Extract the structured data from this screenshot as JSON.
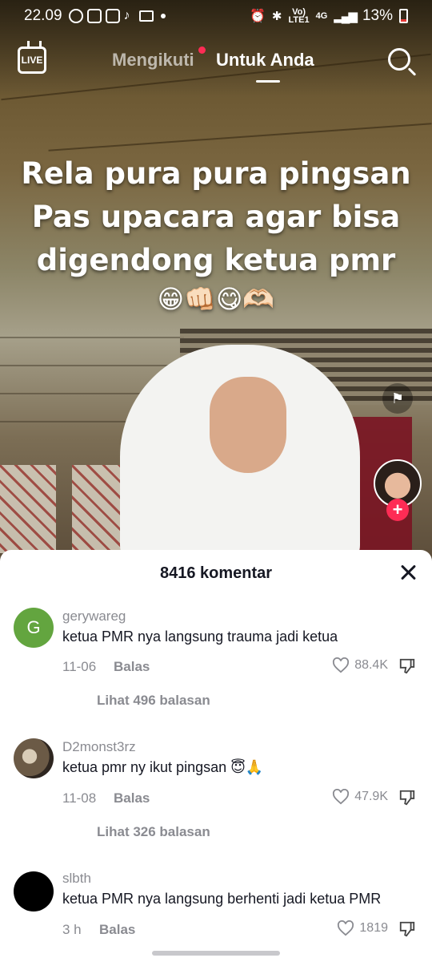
{
  "status_bar": {
    "time": "22.09",
    "volte_line1": "Vo)",
    "volte_line2": "LTE1",
    "network": "4G",
    "battery": "13%"
  },
  "top_nav": {
    "live_label": "LIVE",
    "tabs": [
      {
        "label": "Mengikuti",
        "active": false
      },
      {
        "label": "Untuk Anda",
        "active": true
      }
    ]
  },
  "video": {
    "caption_lines": [
      "Rela pura pura pingsan",
      "Pas upacara agar bisa",
      "digendong ketua pmr"
    ],
    "caption_emoji": "😁👊🏻😋🫶🏻",
    "follow_symbol": "+"
  },
  "comments_panel": {
    "count_label": "8416 komentar",
    "comments": [
      {
        "username": "gerywareg",
        "avatar_initial": "G",
        "avatar_color": "#63a53f",
        "text": "ketua PMR nya langsung trauma jadi ketua",
        "time": "11-06",
        "reply_label": "Balas",
        "likes": "88.4K",
        "view_replies": "Lihat 496 balasan"
      },
      {
        "username": "D2monst3rz",
        "avatar_initial": "",
        "avatar_color": "#5b4a3a",
        "text": "ketua pmr ny ikut pingsan 😇🙏",
        "time": "11-08",
        "reply_label": "Balas",
        "likes": "47.9K",
        "view_replies": "Lihat 326 balasan"
      },
      {
        "username": "slbth",
        "avatar_initial": "",
        "avatar_color": "#000000",
        "text": "ketua PMR nya langsung berhenti jadi ketua PMR",
        "time": "3 h",
        "reply_label": "Balas",
        "likes": "1819",
        "view_replies": ""
      }
    ]
  },
  "colors": {
    "accent": "#fe2c55",
    "secondary_text": "#8a8b91",
    "primary_text": "#161823"
  },
  "icons": [
    "live-icon",
    "search-icon",
    "report-flag-icon",
    "close-icon",
    "heart-icon",
    "dislike-icon"
  ]
}
